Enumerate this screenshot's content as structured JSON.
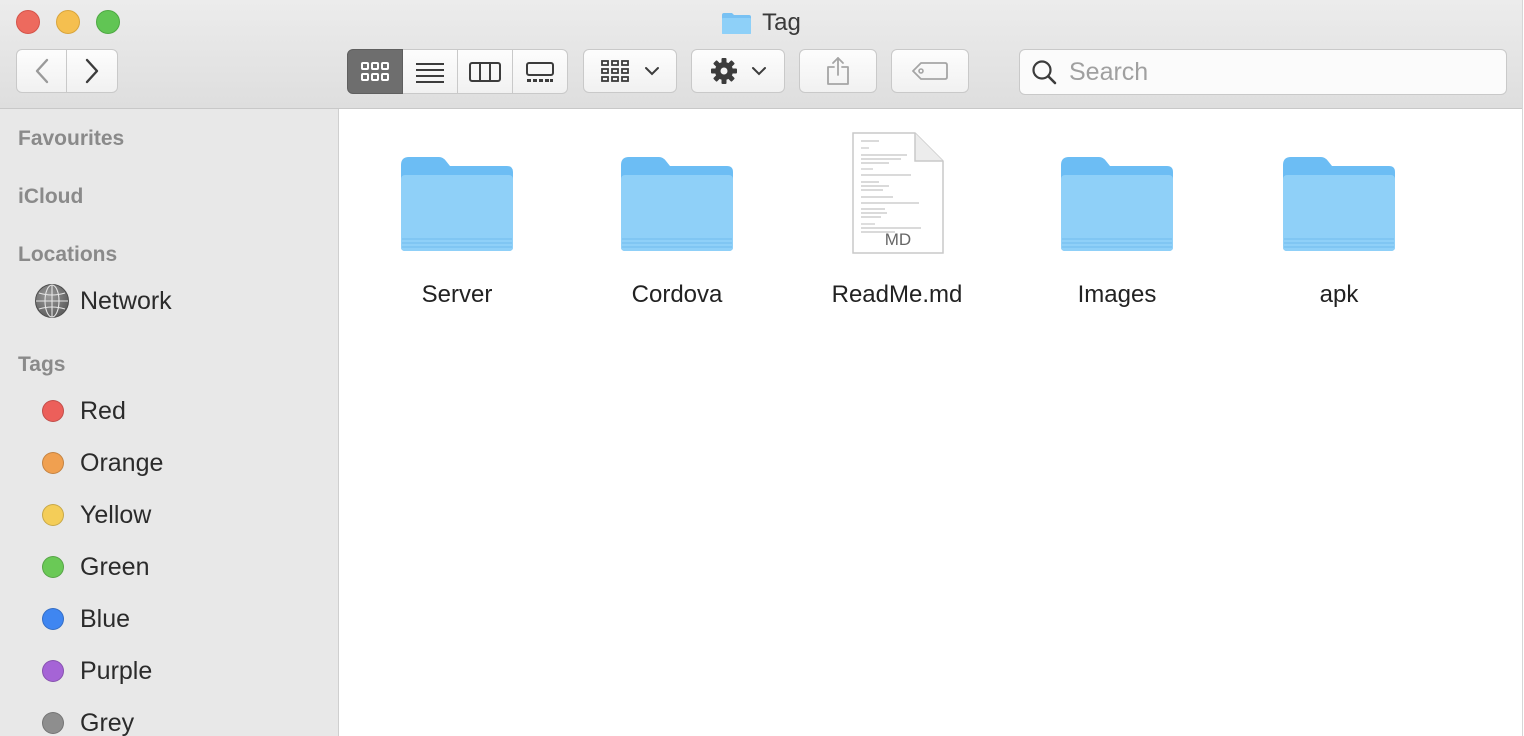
{
  "window": {
    "title": "Tag",
    "title_icon": "folder-icon"
  },
  "toolbar": {
    "nav": {
      "back_icon": "chevron-left-icon",
      "forward_icon": "chevron-right-icon"
    },
    "views": [
      {
        "id": "icon",
        "icon": "icon-view-icon",
        "active": true
      },
      {
        "id": "list",
        "icon": "list-view-icon",
        "active": false
      },
      {
        "id": "column",
        "icon": "column-view-icon",
        "active": false
      },
      {
        "id": "gallery",
        "icon": "gallery-view-icon",
        "active": false
      }
    ],
    "group_icon": "group-grid-icon",
    "action_icon": "gear-icon",
    "share_icon": "share-icon",
    "tag_icon": "tag-icon"
  },
  "search": {
    "placeholder": "Search",
    "value": ""
  },
  "sidebar": {
    "favourites": "Favourites",
    "icloud": "iCloud",
    "locations": "Locations",
    "network": "Network",
    "tags_header": "Tags",
    "tags": [
      {
        "label": "Red",
        "color": "#ec5f5a"
      },
      {
        "label": "Orange",
        "color": "#f0a050"
      },
      {
        "label": "Yellow",
        "color": "#f4cd58"
      },
      {
        "label": "Green",
        "color": "#6ac956"
      },
      {
        "label": "Blue",
        "color": "#3f86f1"
      },
      {
        "label": "Purple",
        "color": "#a564d6"
      },
      {
        "label": "Grey",
        "color": "#8e8e8e"
      }
    ]
  },
  "files": [
    {
      "name": "Server",
      "kind": "folder"
    },
    {
      "name": "Cordova",
      "kind": "folder"
    },
    {
      "name": "ReadMe.md",
      "kind": "document",
      "badge": "MD"
    },
    {
      "name": "Images",
      "kind": "folder"
    },
    {
      "name": "apk",
      "kind": "folder"
    }
  ],
  "colors": {
    "folder_top": "#8fd0f8",
    "folder_body": "#6cbdf4",
    "traffic_close": "#ed6a5e",
    "traffic_min": "#f5bf4f",
    "traffic_max": "#61c554"
  }
}
